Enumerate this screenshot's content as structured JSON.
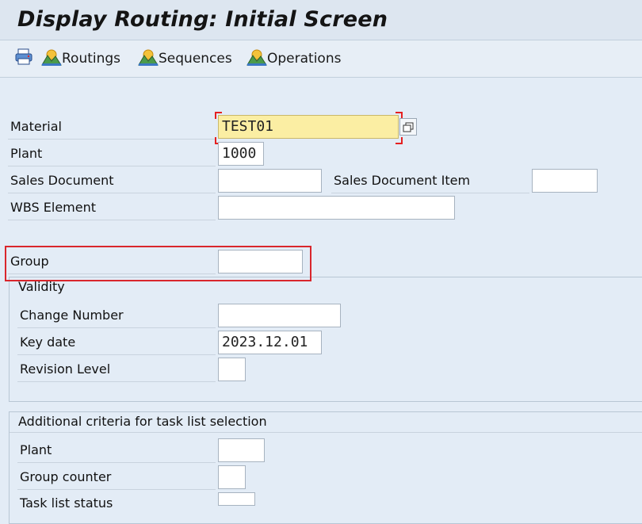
{
  "window": {
    "title": "Display Routing: Initial Screen"
  },
  "toolbar": {
    "items": [
      {
        "label": "",
        "icon": "print-icon"
      },
      {
        "label": "Routings",
        "icon": "mountain-icon"
      },
      {
        "label": "Sequences",
        "icon": "mountain-icon"
      },
      {
        "label": "Operations",
        "icon": "mountain-icon"
      }
    ]
  },
  "form": {
    "material": {
      "label": "Material",
      "value": "TEST01"
    },
    "plant": {
      "label": "Plant",
      "value": "1000"
    },
    "sales_document": {
      "label": "Sales Document",
      "value": ""
    },
    "sales_document_item": {
      "label": "Sales Document Item",
      "value": ""
    },
    "wbs_element": {
      "label": "WBS Element",
      "value": ""
    },
    "group": {
      "label": "Group",
      "value": ""
    }
  },
  "validity": {
    "title": "Validity",
    "change_number": {
      "label": "Change Number",
      "value": ""
    },
    "key_date": {
      "label": "Key date",
      "value": "2023.12.01"
    },
    "revision_level": {
      "label": "Revision Level",
      "value": ""
    }
  },
  "additional": {
    "title": "Additional criteria for task list selection",
    "plant": {
      "label": "Plant",
      "value": ""
    },
    "group_counter": {
      "label": "Group counter",
      "value": ""
    },
    "task_list_status": {
      "label": "Task list status",
      "value": ""
    }
  },
  "colors": {
    "required_field": "#fbeea3",
    "highlight": "#d9262c",
    "background": "#e3ecf6"
  }
}
